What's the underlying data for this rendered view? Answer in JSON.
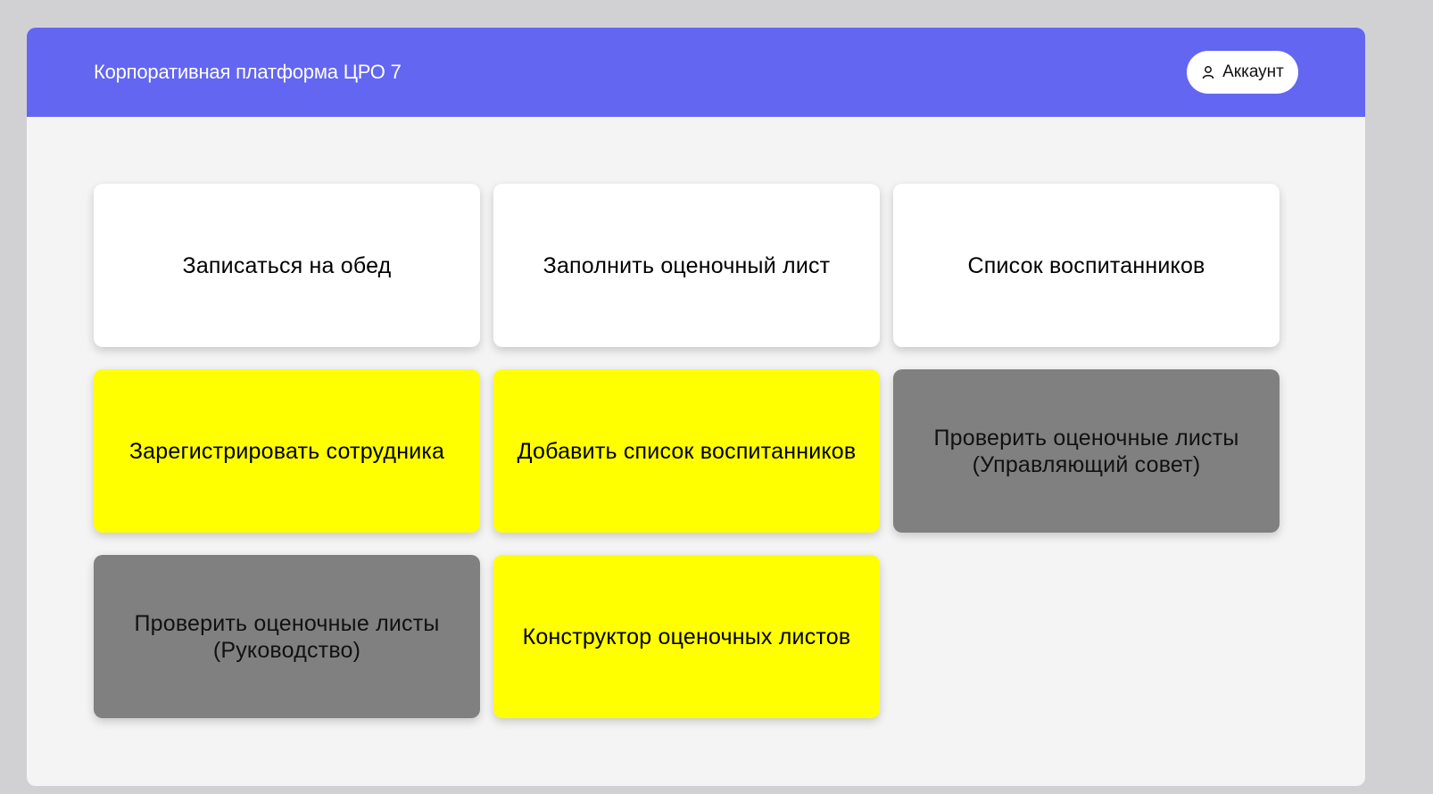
{
  "header": {
    "title": "Корпоративная платформа ЦРО 7",
    "background": "#6366f1",
    "account_button": {
      "label": "Аккаунт",
      "icon": "user-icon"
    }
  },
  "tiles": [
    {
      "label": "Записаться на обед",
      "color": "#ffffff"
    },
    {
      "label": "Заполнить оценочный лист",
      "color": "#ffffff"
    },
    {
      "label": "Список воспитанников",
      "color": "#ffffff"
    },
    {
      "label": "Зарегистрировать сотрудника",
      "color": "#ffff00"
    },
    {
      "label": "Добавить список воспитанников",
      "color": "#ffff00"
    },
    {
      "label": "Проверить оценочные листы (Управляющий совет)",
      "color": "#808080"
    },
    {
      "label": "Проверить оценочные листы (Руководство)",
      "color": "#808080"
    },
    {
      "label": "Конструктор оценочных листов",
      "color": "#ffff00"
    }
  ]
}
